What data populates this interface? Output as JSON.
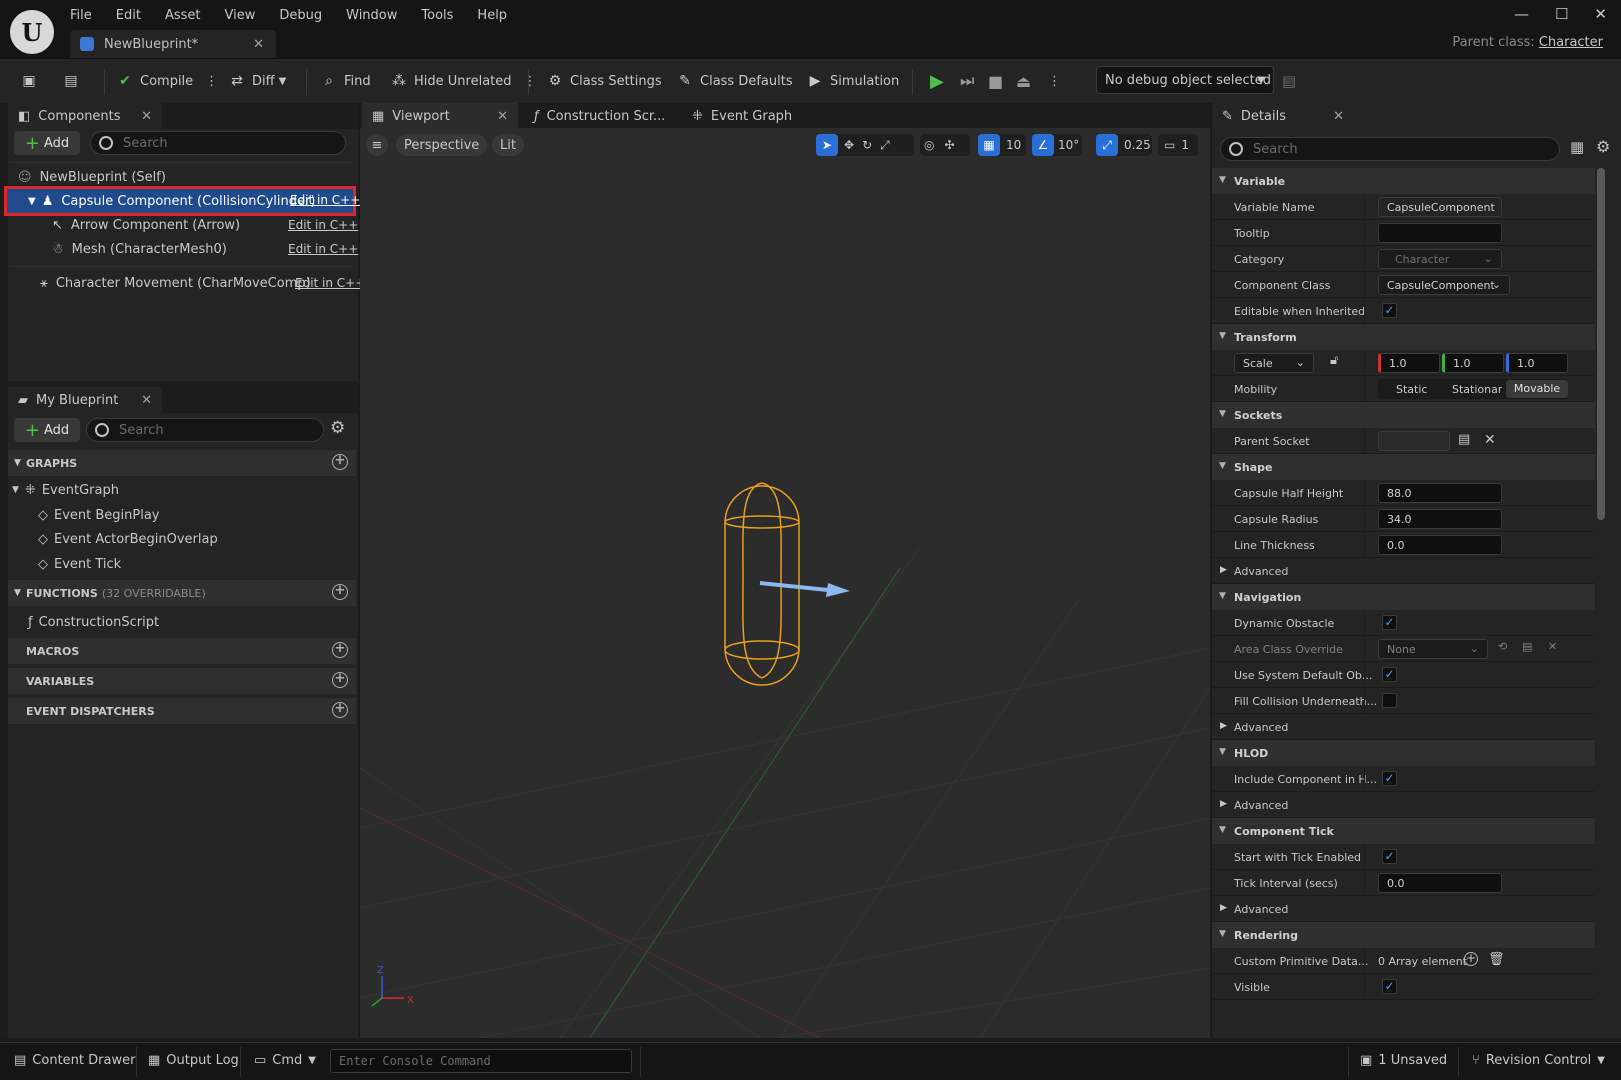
{
  "app": {
    "logo_text": "U",
    "menu": [
      "File",
      "Edit",
      "Asset",
      "View",
      "Debug",
      "Window",
      "Tools",
      "Help"
    ],
    "doc_tab": "NewBlueprint*",
    "parent_class_label": "Parent class:",
    "parent_class_value": "Character",
    "window_controls": {
      "minimize": "—",
      "maximize": "☐",
      "close": "✕"
    }
  },
  "toolbar": {
    "compile": "Compile",
    "diff": "Diff",
    "find": "Find",
    "hide_unrelated": "Hide Unrelated",
    "class_settings": "Class Settings",
    "class_defaults": "Class Defaults",
    "simulation": "Simulation",
    "debug_object": "No debug object selected"
  },
  "components": {
    "tab": "Components",
    "add": "Add",
    "search_placeholder": "Search",
    "items": [
      {
        "label": "NewBlueprint (Self)"
      },
      {
        "label": "Capsule Component (CollisionCylinder)",
        "edit": "Edit in C++",
        "selected": true
      },
      {
        "label": "Arrow Component (Arrow)",
        "edit": "Edit in C++"
      },
      {
        "label": "Mesh (CharacterMesh0)",
        "edit": "Edit in C++"
      },
      {
        "label": "Character Movement (CharMoveComp)",
        "edit": "Edit in C++"
      }
    ]
  },
  "my_blueprint": {
    "tab": "My Blueprint",
    "add": "Add",
    "search_placeholder": "Search",
    "graphs": "GRAPHS",
    "event_graph": "EventGraph",
    "events": [
      "Event BeginPlay",
      "Event ActorBeginOverlap",
      "Event Tick"
    ],
    "functions": "FUNCTIONS",
    "functions_count": "(32 OVERRIDABLE)",
    "construction_script": "ConstructionScript",
    "macros": "MACROS",
    "variables": "VARIABLES",
    "event_dispatchers": "EVENT DISPATCHERS"
  },
  "editor_tabs": {
    "viewport": "Viewport",
    "construction": "Construction Scr...",
    "event_graph": "Event Graph"
  },
  "viewport": {
    "perspective": "Perspective",
    "lit": "Lit",
    "grid_snap": "10",
    "rotation_snap": "10°",
    "scale_snap": "0.25",
    "camera_speed": "1",
    "axis_x": "X",
    "axis_z": "Z"
  },
  "details": {
    "tab": "Details",
    "search_placeholder": "Search",
    "variable": "Variable",
    "variable_name_lbl": "Variable Name",
    "variable_name_val": "CapsuleComponent",
    "tooltip_lbl": "Tooltip",
    "category_lbl": "Category",
    "category_val": "Character",
    "component_class_lbl": "Component Class",
    "component_class_val": "CapsuleComponent",
    "editable_inherited_lbl": "Editable when Inherited",
    "transform": "Transform",
    "scale_lbl": "Scale",
    "scale_x": "1.0",
    "scale_y": "1.0",
    "scale_z": "1.0",
    "mobility_lbl": "Mobility",
    "mobility_static": "Static",
    "mobility_stationary": "Stationar",
    "mobility_movable": "Movable",
    "sockets": "Sockets",
    "parent_socket_lbl": "Parent Socket",
    "shape": "Shape",
    "half_height_lbl": "Capsule Half Height",
    "half_height_val": "88.0",
    "radius_lbl": "Capsule Radius",
    "radius_val": "34.0",
    "line_thickness_lbl": "Line Thickness",
    "line_thickness_val": "0.0",
    "advanced": "Advanced",
    "navigation": "Navigation",
    "dynamic_obstacle_lbl": "Dynamic Obstacle",
    "area_class_lbl": "Area Class Override",
    "area_class_val": "None",
    "use_system_default_lbl": "Use System Default Ob...",
    "fill_collision_lbl": "Fill Collision Underneath...",
    "hlod": "HLOD",
    "include_component_lbl": "Include Component in H...",
    "component_tick": "Component Tick",
    "start_tick_lbl": "Start with Tick Enabled",
    "tick_interval_lbl": "Tick Interval (secs)",
    "tick_interval_val": "0.0",
    "rendering": "Rendering",
    "custom_primitive_lbl": "Custom Primitive Data...",
    "custom_primitive_val": "0 Array element",
    "visible_lbl": "Visible"
  },
  "statusbar": {
    "content_drawer": "Content Drawer",
    "output_log": "Output Log",
    "cmd": "Cmd",
    "console_placeholder": "Enter Console Command",
    "unsaved": "1 Unsaved",
    "revision_control": "Revision Control"
  },
  "colors": {
    "accent": "#2a6fd6",
    "selection_outline": "#e0262a",
    "capsule": "#e8a020",
    "arrow": "#8ab8f0",
    "play": "#4cc04c"
  }
}
